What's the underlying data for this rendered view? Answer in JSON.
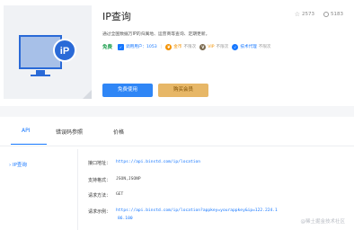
{
  "header": {
    "title": "IP查询",
    "favorites": "2573",
    "users": "5183",
    "description": "通过全国数据万IP的归属地、运营商等查询、定期更新。",
    "free_badge": "免费",
    "tags": {
      "developers": "调用用户：1053",
      "gold": "金币",
      "gold_note": "不限次",
      "vip": "VIP",
      "vip_note": "不限次",
      "tech": "技术代理",
      "tech_note": "不限次"
    },
    "buy_label": "免费使用",
    "vip_label": "购买会员"
  },
  "tabs": [
    {
      "label": "API"
    },
    {
      "label": "错误码参照"
    },
    {
      "label": "价格"
    }
  ],
  "sidebar": {
    "item": "IP查询"
  },
  "api": {
    "url_label": "接口地址：",
    "url_value": "https://api.binstd.com/ip/location",
    "format_label": "支持格式：",
    "format_value": "JSON,JSONP",
    "method_label": "请求方法：",
    "method_value": "GET",
    "example_label": "请求示例：",
    "example_value": "https://api.binstd.com/ip/location?appkey=yourappkey&ip=122.224.1",
    "example_value_2": "86.100"
  },
  "watermark": "@稀土掘金技术社区",
  "colors": {
    "accent": "#1677ff",
    "buy": "#2f86f6",
    "vip": "#e7b767"
  }
}
